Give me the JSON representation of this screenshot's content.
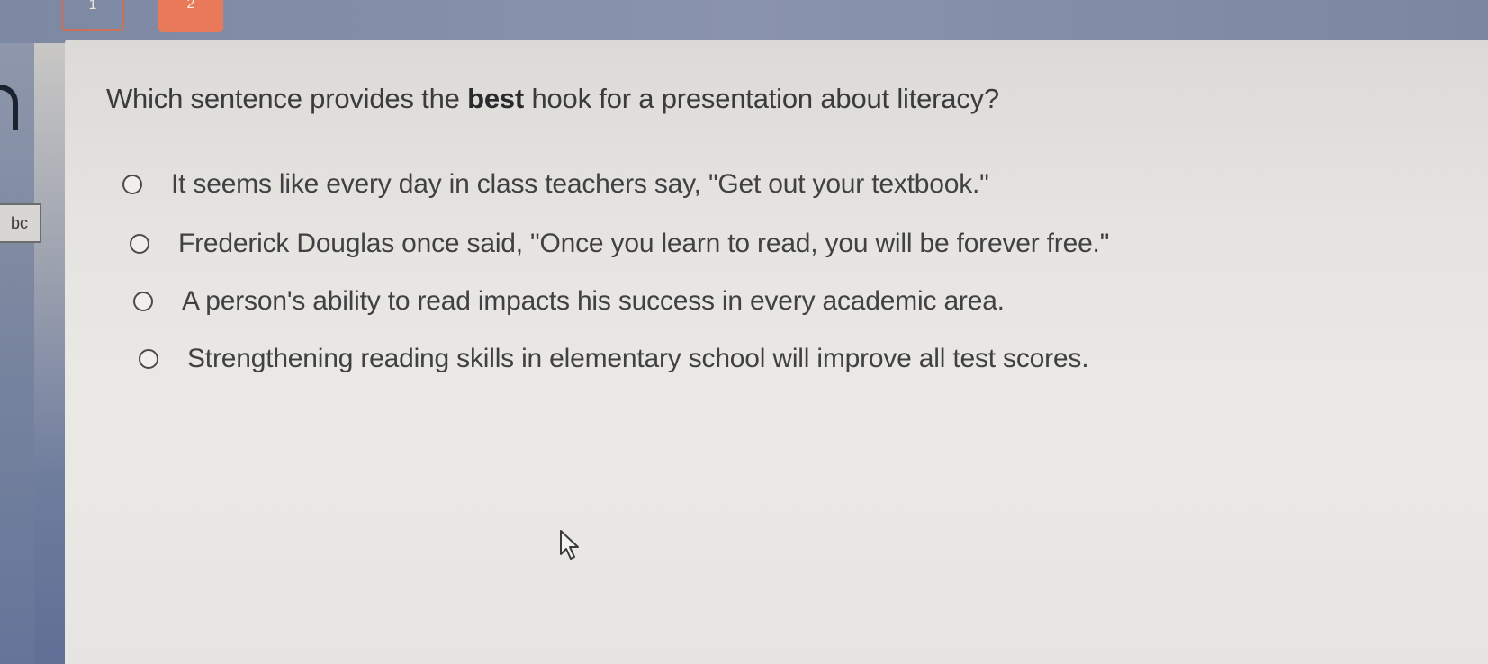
{
  "header": {
    "tab_left_label": "1",
    "tab_right_label": "2"
  },
  "toolbar": {
    "abc_tool_label": "bc"
  },
  "question": {
    "prefix": "Which sentence provides the ",
    "emphasis": "best",
    "suffix": " hook for a presentation about literacy?"
  },
  "options": [
    {
      "label": "It seems like every day in class teachers say, \"Get out your textbook.\""
    },
    {
      "label": "Frederick Douglas once said, \"Once you learn to read, you will be forever free.\""
    },
    {
      "label": "A person's ability to read impacts his success in every academic area."
    },
    {
      "label": "Strengthening reading skills in elementary school will improve all test scores."
    }
  ],
  "colors": {
    "accent": "#e87a5a",
    "panel": "#e6e4e0",
    "rail": "#6e7d99"
  }
}
